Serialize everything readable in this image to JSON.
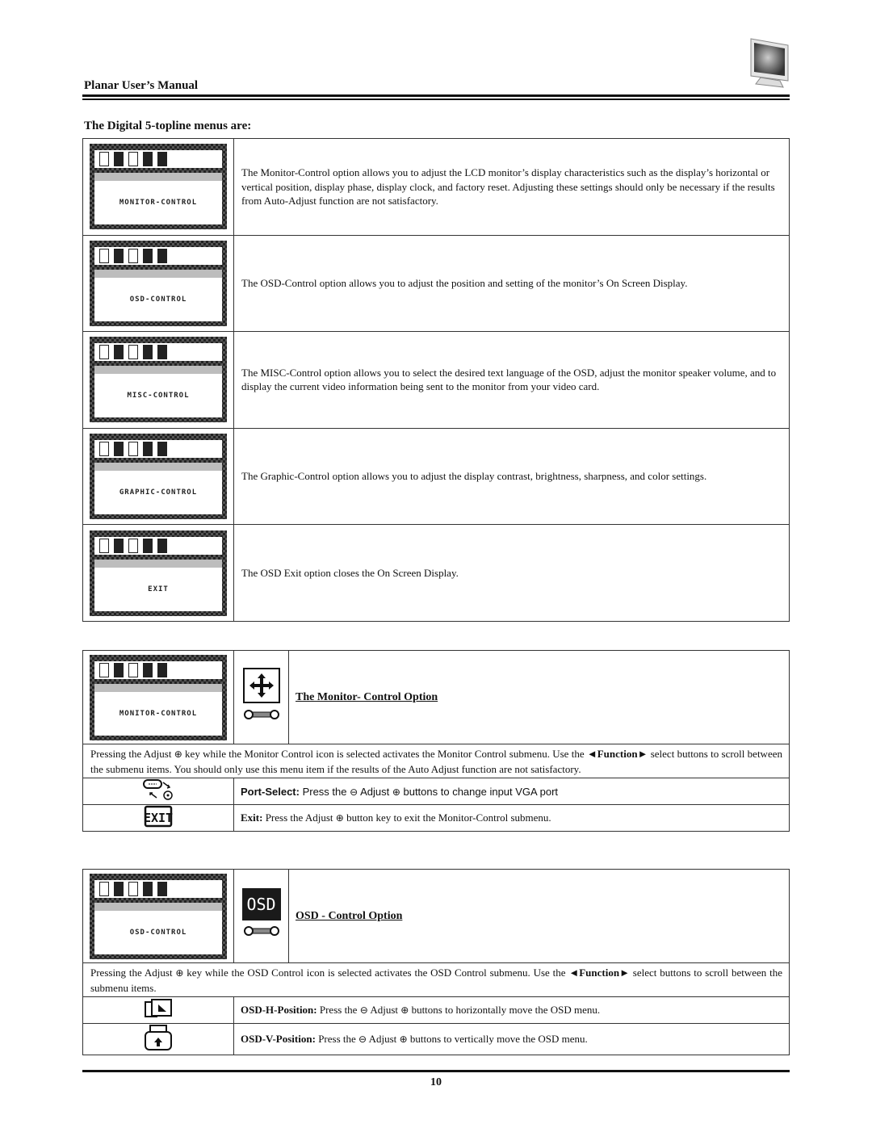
{
  "header": {
    "title": "Planar User’s Manual",
    "monitor_icon": "lcd-monitor-icon"
  },
  "section_title": "The Digital 5-topline menus are:",
  "topline_menus": [
    {
      "osd_label": "MONITOR-CONTROL",
      "description": "The Monitor-Control option allows you to adjust the LCD monitor’s display characteristics such as the display’s horizontal or vertical position, display phase, display clock, and factory reset.  Adjusting these settings should only be necessary if the results from Auto-Adjust function are not satisfactory."
    },
    {
      "osd_label": "OSD-CONTROL",
      "description": "The OSD-Control option allows you to adjust the position and setting of the monitor’s On Screen Display."
    },
    {
      "osd_label": "MISC-CONTROL",
      "description": "The MISC-Control option allows you to select the desired text language of the OSD, adjust the monitor speaker volume, and to display the current video information being sent to the monitor from your video card."
    },
    {
      "osd_label": "GRAPHIC-CONTROL",
      "description": "The Graphic-Control option allows you to adjust the display contrast, brightness, sharpness, and color settings."
    },
    {
      "osd_label": "EXIT",
      "description": "The OSD Exit option closes the On Screen Display."
    }
  ],
  "monitor_control": {
    "osd_label": "MONITOR-CONTROL",
    "icon": "move-arrows-icon",
    "heading": "The Monitor- Control Option",
    "para_pre": "Pressing the Adjust ",
    "para_mid": " key while the Monitor Control icon is selected activates the Monitor Control submenu.  Use the ",
    "function_label": "◄Function►",
    "para_post": " select buttons to scroll between the submenu items.  You should only use this menu item if the results of the Auto Adjust function are not satisfactory.",
    "items": [
      {
        "icon": "port-select-icon",
        "label": "Port-Select:",
        "pre": " Press the ",
        "mid": " Adjust ",
        "post": " buttons to change input VGA port"
      },
      {
        "icon": "exit-icon",
        "label": "Exit:",
        "pre": " Press the Adjust ",
        "post": " button key to exit the Monitor-Control submenu."
      }
    ]
  },
  "osd_control": {
    "osd_label": "OSD-CONTROL",
    "icon": "osd-icon",
    "icon_text": "OSD",
    "heading": "OSD - Control Option",
    "para_pre": "Pressing the Adjust ",
    "para_mid": " key while the OSD Control icon is selected activates the OSD Control submenu.  Use the ",
    "function_label": "◄Function►",
    "para_post": " select buttons to scroll between the submenu items.",
    "items": [
      {
        "icon": "osd-h-position-icon",
        "label": "OSD-H-Position:",
        "pre": " Press the ",
        "mid": " Adjust ",
        "post": " buttons to horizontally move the OSD menu."
      },
      {
        "icon": "osd-v-position-icon",
        "label": "OSD-V-Position:",
        "pre": " Press the ",
        "mid": " Adjust ",
        "post": " buttons to vertically move the OSD menu."
      }
    ]
  },
  "symbols": {
    "plus": "⊕",
    "minus": "⊖"
  },
  "page_number": "10"
}
